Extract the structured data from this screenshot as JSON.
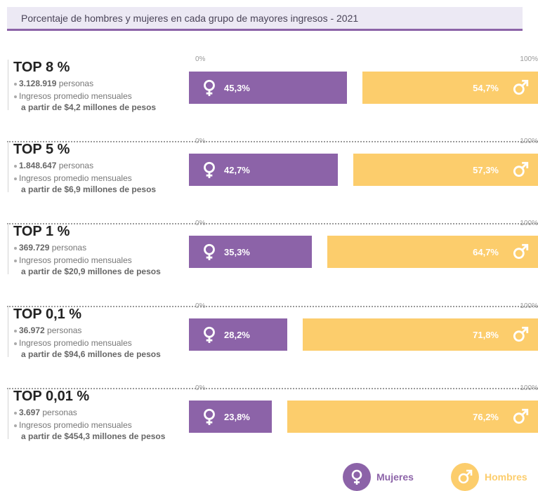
{
  "title": "Porcentaje de hombres y mujeres en cada grupo de mayores ingresos - 2021",
  "axis": {
    "min_label": "0%",
    "max_label": "100%"
  },
  "colors": {
    "mujeres": "#8c63a8",
    "hombres": "#fccd6c"
  },
  "groups": [
    {
      "label": "TOP 8 %",
      "people": "3.128.919",
      "people_suffix": "personas",
      "income_label": "Ingresos promedio mensuales",
      "income_from": "a partir de $4,2 millones de pesos",
      "women_label": "45,3%",
      "men_label": "54,7%"
    },
    {
      "label": "TOP 5 %",
      "people": "1.848.647",
      "people_suffix": "personas",
      "income_label": "Ingresos promedio mensuales",
      "income_from": "a partir de $6,9 millones de pesos",
      "women_label": "42,7%",
      "men_label": "57,3%"
    },
    {
      "label": "TOP 1 %",
      "people": "369.729",
      "people_suffix": "personas",
      "income_label": "Ingresos promedio mensuales",
      "income_from": "a partir de $20,9 millones de pesos",
      "women_label": "35,3%",
      "men_label": "64,7%"
    },
    {
      "label": "TOP 0,1 %",
      "people": "36.972",
      "people_suffix": "personas",
      "income_label": "Ingresos promedio mensuales",
      "income_from": "a partir de $94,6 millones de pesos",
      "women_label": "28,2%",
      "men_label": "71,8%"
    },
    {
      "label": "TOP 0,01 %",
      "people": "3.697",
      "people_suffix": "personas",
      "income_label": "Ingresos promedio mensuales",
      "income_from": "a partir de $454,3 millones de pesos",
      "women_label": "23,8%",
      "men_label": "76,2%"
    }
  ],
  "legend": {
    "women": "Mujeres",
    "men": "Hombres"
  },
  "icons": {
    "women": "female-symbol-icon",
    "men": "male-symbol-icon"
  },
  "chart_data": {
    "type": "bar",
    "stacked": true,
    "orientation": "horizontal",
    "title": "Porcentaje de hombres y mujeres en cada grupo de mayores ingresos - 2021",
    "categories": [
      "TOP 8 %",
      "TOP 5 %",
      "TOP 1 %",
      "TOP 0,1 %",
      "TOP 0,01 %"
    ],
    "series": [
      {
        "name": "Mujeres",
        "values": [
          45.3,
          42.7,
          35.3,
          28.2,
          23.8
        ]
      },
      {
        "name": "Hombres",
        "values": [
          54.7,
          57.3,
          64.7,
          71.8,
          76.2
        ]
      }
    ],
    "xlim": [
      0,
      100
    ],
    "legend_position": "bottom-right",
    "grid": false
  }
}
